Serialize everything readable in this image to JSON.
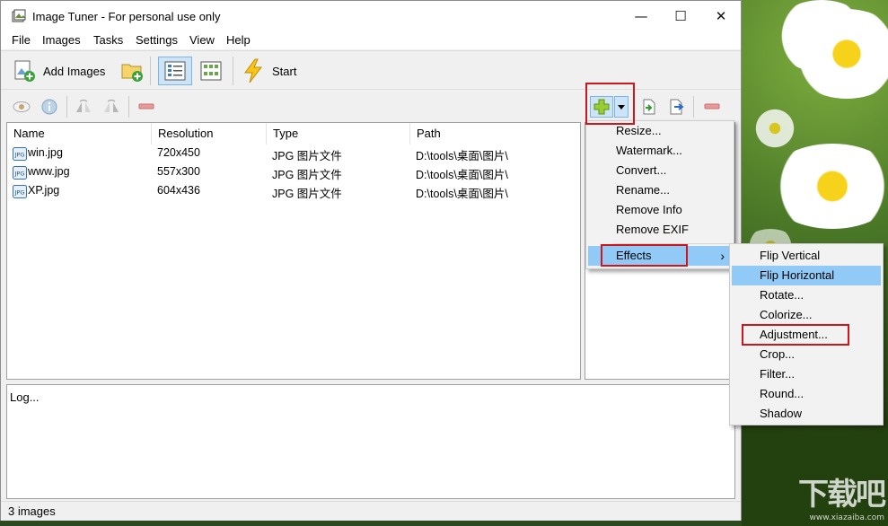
{
  "window": {
    "title": "Image Tuner - For personal use only",
    "controls": {
      "minimize": "—",
      "maximize": "☐",
      "close": "✕"
    }
  },
  "menu": [
    "File",
    "Images",
    "Tasks",
    "Settings",
    "View",
    "Help"
  ],
  "toolbar": {
    "add_images_label": "Add Images",
    "start_label": "Start",
    "icons": [
      "add-images-icon",
      "add-folder-icon",
      "details-view-icon",
      "thumbnails-view-icon",
      "lightning-icon"
    ]
  },
  "secondary_toolbar": {
    "icons": [
      "eye-icon",
      "info-icon",
      "flip-left-icon",
      "flip-right-icon",
      "remove-icon",
      "add-task-icon",
      "dropdown-arrow-icon",
      "import-icon",
      "export-icon",
      "remove-task-icon"
    ]
  },
  "file_list": {
    "columns": [
      "Name",
      "Resolution",
      "Type",
      "Path"
    ],
    "rows": [
      {
        "name": "win.jpg",
        "resolution": "720x450",
        "type": "JPG 图片文件",
        "path": "D:\\tools\\桌面\\图片\\"
      },
      {
        "name": "www.jpg",
        "resolution": "557x300",
        "type": "JPG 图片文件",
        "path": "D:\\tools\\桌面\\图片\\"
      },
      {
        "name": "XP.jpg",
        "resolution": "604x436",
        "type": "JPG 图片文件",
        "path": "D:\\tools\\桌面\\图片\\"
      }
    ],
    "file_icon_label": "JPG"
  },
  "log": {
    "text": "Log..."
  },
  "status": {
    "text": "3 images"
  },
  "task_menu": {
    "items": [
      "Resize...",
      "Watermark...",
      "Convert...",
      "Rename...",
      "Remove Info",
      "Remove EXIF"
    ],
    "effects_label": "Effects",
    "submenu_arrow": "›"
  },
  "effects_menu": {
    "items": [
      "Flip Vertical",
      "Flip Horizontal",
      "Rotate...",
      "Colorize...",
      "Adjustment...",
      "Crop...",
      "Filter...",
      "Round...",
      "Shadow"
    ],
    "highlighted": "Flip Horizontal"
  },
  "wallpaper": {
    "logo_text": "下载吧",
    "logo_url": "www.xiazaiba.com"
  },
  "colors": {
    "highlight": "#91c9f7",
    "annotation_red": "#d0161d",
    "pressed_button": "#cce4f7"
  }
}
